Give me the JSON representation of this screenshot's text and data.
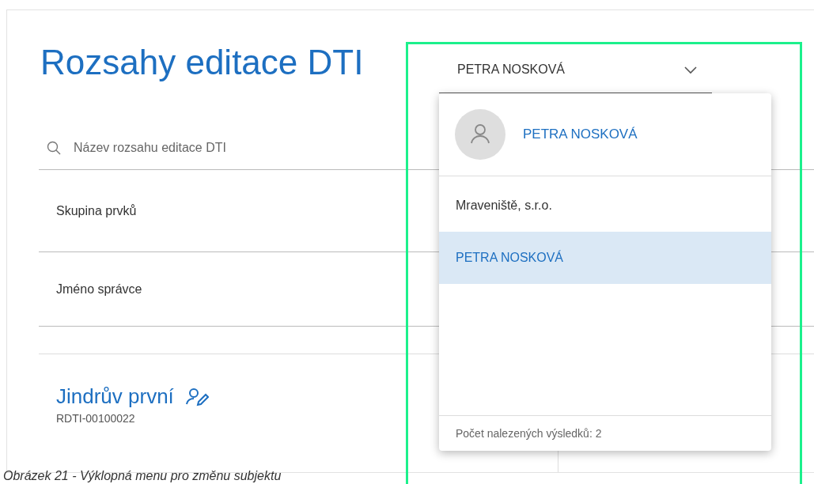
{
  "page": {
    "title": "Rozsahy editace DTI"
  },
  "subject_select": {
    "value": "PETRA NOSKOVÁ",
    "expanded": true
  },
  "search": {
    "placeholder": "Název rozsahu editace DTI"
  },
  "filters": [
    {
      "label": "Skupina prvků"
    },
    {
      "label": "Jméno správce"
    }
  ],
  "result": {
    "name": "Jindrův první",
    "code": "RDTI-00100022"
  },
  "menu": {
    "user": "PETRA NOSKOVÁ",
    "items": [
      {
        "label": "Mraveniště, s.r.o.",
        "selected": false
      },
      {
        "label": "PETRA NOSKOVÁ",
        "selected": true
      }
    ],
    "footer": "Počet nalezených výsledků: 2"
  },
  "caption": "Obrázek 21 - Výklopná menu pro změnu subjektu"
}
